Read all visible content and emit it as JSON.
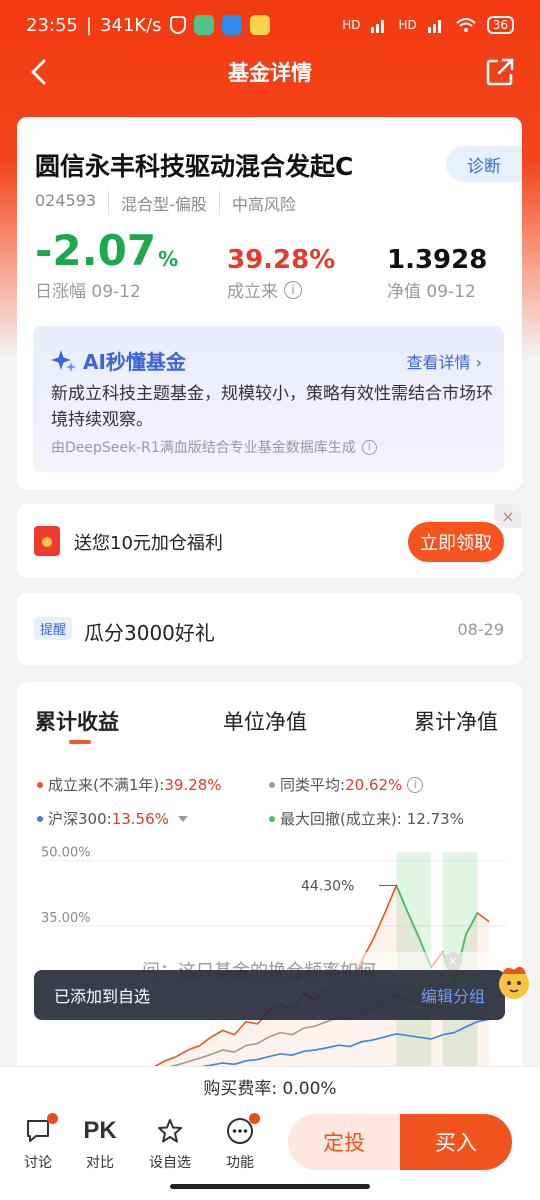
{
  "status": {
    "time": "23:55",
    "speed": "341K/s",
    "battery": "36",
    "signal1": "HD",
    "signal2": "HD"
  },
  "nav": {
    "title": "基金详情",
    "back_icon": "back-arrow-icon",
    "share_icon": "share-icon"
  },
  "fund": {
    "name": "圆信永丰科技驱动混合发起C",
    "diagnose_label": "诊断",
    "code": "024593",
    "type": "混合型-偏股",
    "risk": "中高风险",
    "daily_change": "-2.07",
    "daily_change_unit": "%",
    "daily_label": "日涨幅 09-12",
    "since_inception": "39.28%",
    "since_label": "成立来",
    "nav_value": "1.3928",
    "nav_label": "净值 09-12"
  },
  "ai": {
    "title": "AI秒懂基金",
    "more": "查看详情",
    "text": "新成立科技主题基金，规模较小，策略有效性需结合市场环境持续观察。",
    "source": "由DeepSeek-R1满血版结合专业基金数据库生成"
  },
  "promo": {
    "text": "送您10元加仓福利",
    "button": "立即领取"
  },
  "reminder": {
    "badge": "提醒",
    "text": "瓜分3000好礼",
    "date": "08-29"
  },
  "chart_tabs": [
    "累计收益",
    "单位净值",
    "累计净值"
  ],
  "legend": {
    "fund_label": "成立来(不满1年):",
    "fund_value": "39.28%",
    "peer_label": "同类平均:",
    "peer_value": "20.62%",
    "hs300_label": "沪深300:",
    "hs300_value": "13.56%",
    "drawdown_label": "最大回撤(成立来):",
    "drawdown_value": "12.73%"
  },
  "chart_data": {
    "type": "line",
    "y_ticks": [
      "50.00%",
      "35.00%"
    ],
    "annotation": "44.30%",
    "ylim": [
      -5,
      52
    ],
    "series": [
      {
        "name": "成立来(不满1年)",
        "color": "#f0541c",
        "values": [
          0,
          0.5,
          1,
          1.5,
          2.5,
          4,
          5,
          6.5,
          7.5,
          9.5,
          11,
          10,
          13,
          12.5,
          15.5,
          17,
          16,
          19.5,
          18,
          21,
          22.5,
          21,
          27,
          32,
          38,
          44.3,
          38,
          32,
          25.5,
          29,
          22,
          33,
          38,
          36
        ]
      },
      {
        "name": "同类平均",
        "color": "#9a9a9a",
        "values": [
          0,
          0.2,
          0.5,
          1,
          1.6,
          2.4,
          3,
          3.8,
          4.6,
          5.5,
          6.5,
          6,
          7.5,
          8,
          9.5,
          10.5,
          10,
          11.5,
          12,
          13,
          14,
          13.5,
          15.5,
          16,
          17.5,
          19,
          18,
          17,
          16.5,
          18,
          17.5,
          19.5,
          20.5,
          20.6
        ]
      },
      {
        "name": "沪深300",
        "color": "#3b82e0",
        "values": [
          0,
          0.1,
          0.3,
          0.6,
          1,
          1.4,
          1.8,
          2.2,
          2.6,
          3,
          3.5,
          3.2,
          4,
          4.3,
          5,
          5.6,
          5.3,
          6.2,
          6.5,
          7,
          7.6,
          7.3,
          8.4,
          8.8,
          9.5,
          10.2,
          9.8,
          9.4,
          9,
          10,
          10.5,
          11.8,
          13,
          13.56
        ]
      }
    ],
    "drawdown_shading": [
      [
        25,
        28
      ],
      [
        29,
        32
      ]
    ]
  },
  "toast": {
    "message": "已添加到自选",
    "action": "编辑分组",
    "overlay_question": "问：这只基金的换仓频率如何"
  },
  "fee": "购买费率: 0.00%",
  "bottom": {
    "discuss": "讨论",
    "compare": "对比",
    "compare_icon_text": "PK",
    "watchlist": "设自选",
    "function": "功能",
    "fixed": "定投",
    "buy": "买入"
  }
}
